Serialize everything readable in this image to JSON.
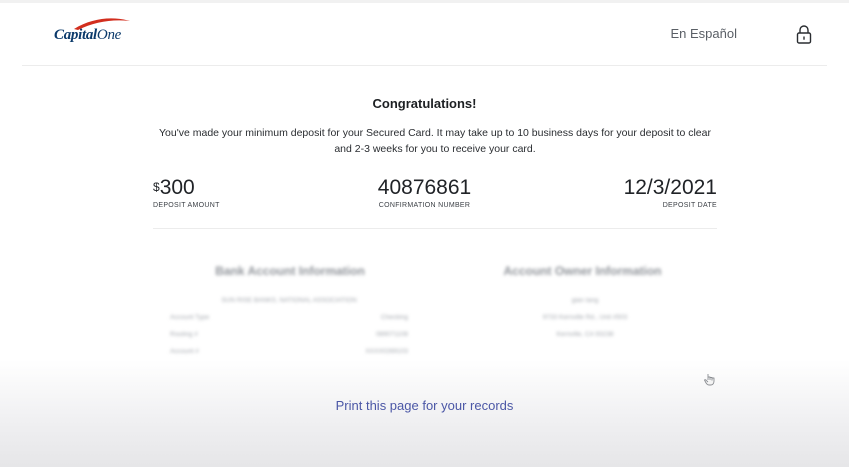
{
  "header": {
    "brand": {
      "name": "Capital",
      "name_suffix": "One"
    },
    "language_link": "En Español",
    "lock_icon": "lock-icon"
  },
  "confirmation": {
    "title": "Congratulations!",
    "message": "You've made your minimum deposit for your Secured Card. It may take up to 10 business days for your deposit to clear and 2-3 weeks for you to receive your card.",
    "deposit_amount": {
      "currency_symbol": "$",
      "value": "300",
      "label": "DEPOSIT AMOUNT"
    },
    "confirmation_number": {
      "value": "40876861",
      "label": "CONFIRMATION NUMBER"
    },
    "deposit_date": {
      "value": "12/3/2021",
      "label": "DEPOSIT DATE"
    }
  },
  "bank_info": {
    "heading": "Bank Account Information",
    "bank_name": "SUN RISE BANKS, NATIONAL ASSOCIATION",
    "rows": [
      {
        "label": "Account Type",
        "value": "Checking"
      },
      {
        "label": "Routing #",
        "value": "089071108"
      },
      {
        "label": "Account #",
        "value": "XXXX0269103"
      }
    ]
  },
  "owner_info": {
    "heading": "Account Owner Information",
    "lines": [
      "gian tang",
      "9733 Kernville Rd., Unit #503",
      "Kernville, CA 93238"
    ]
  },
  "footer": {
    "print_link": "Print this page for your records"
  },
  "colors": {
    "brand_blue": "#0b3a6b",
    "brand_red": "#d22e1e",
    "link": "#4b57a6"
  }
}
